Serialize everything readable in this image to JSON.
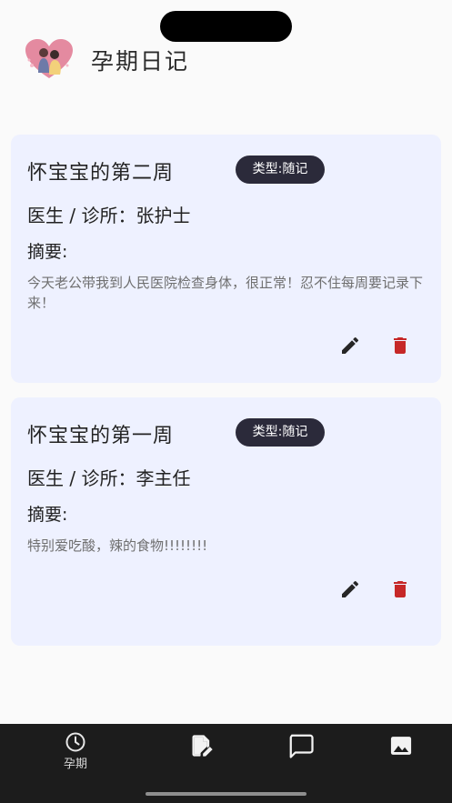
{
  "app": {
    "title": "孕期日记"
  },
  "entries": [
    {
      "title": "怀宝宝的第二周",
      "type": "类型:随记",
      "doctor": "医生 / 诊所：张护士",
      "summary_label": "摘要:",
      "summary": "今天老公带我到人民医院检查身体，很正常！忍不住每周要记录下来！"
    },
    {
      "title": "怀宝宝的第一周",
      "type": "类型:随记",
      "doctor": "医生 / 诊所：李主任",
      "summary_label": "摘要:",
      "summary": "特别爱吃酸，辣的食物!!!!!!!!"
    }
  ],
  "nav": {
    "items": [
      {
        "label": "孕期",
        "icon": "clock-icon",
        "active": true
      },
      {
        "label": "",
        "icon": "edit-note-icon",
        "active": false
      },
      {
        "label": "",
        "icon": "chat-icon",
        "active": false
      },
      {
        "label": "",
        "icon": "image-icon",
        "active": false
      }
    ]
  },
  "colors": {
    "card_bg": "#eef1ff",
    "badge_bg": "#2b2a3a",
    "delete_red": "#c62828",
    "navbar_bg": "#1c1c1c"
  }
}
